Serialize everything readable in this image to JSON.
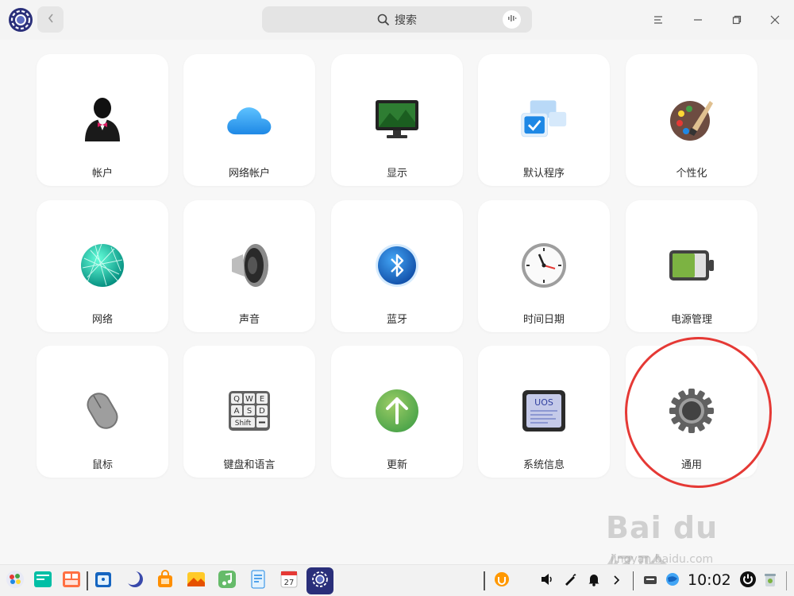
{
  "titlebar": {
    "search_placeholder": "搜索"
  },
  "tiles": [
    {
      "label": "帐户",
      "icon": "account-icon"
    },
    {
      "label": "网络帐户",
      "icon": "cloud-icon"
    },
    {
      "label": "显示",
      "icon": "display-icon"
    },
    {
      "label": "默认程序",
      "icon": "default-apps-icon"
    },
    {
      "label": "个性化",
      "icon": "palette-icon"
    },
    {
      "label": "网络",
      "icon": "network-icon"
    },
    {
      "label": "声音",
      "icon": "speaker-icon"
    },
    {
      "label": "蓝牙",
      "icon": "bluetooth-icon"
    },
    {
      "label": "时间日期",
      "icon": "clock-icon"
    },
    {
      "label": "电源管理",
      "icon": "battery-icon"
    },
    {
      "label": "鼠标",
      "icon": "mouse-icon"
    },
    {
      "label": "键盘和语言",
      "icon": "keyboard-icon"
    },
    {
      "label": "更新",
      "icon": "update-icon"
    },
    {
      "label": "系统信息",
      "icon": "system-info-icon"
    },
    {
      "label": "通用",
      "icon": "gear-icon"
    }
  ],
  "keyboard_keys": [
    "Q",
    "W",
    "E",
    "A",
    "S",
    "D",
    "Shift"
  ],
  "system_info_text": "UOS",
  "calendar_day": "27",
  "tray": {
    "clock": "10:02"
  },
  "watermark": {
    "main": "Bai du 经验",
    "sub": "jingyan.baidu.com"
  },
  "colors": {
    "accent_blue": "#1e88e5",
    "highlight_red": "#e53935",
    "tile_bg": "#ffffff",
    "page_bg": "#f7f7f7"
  }
}
